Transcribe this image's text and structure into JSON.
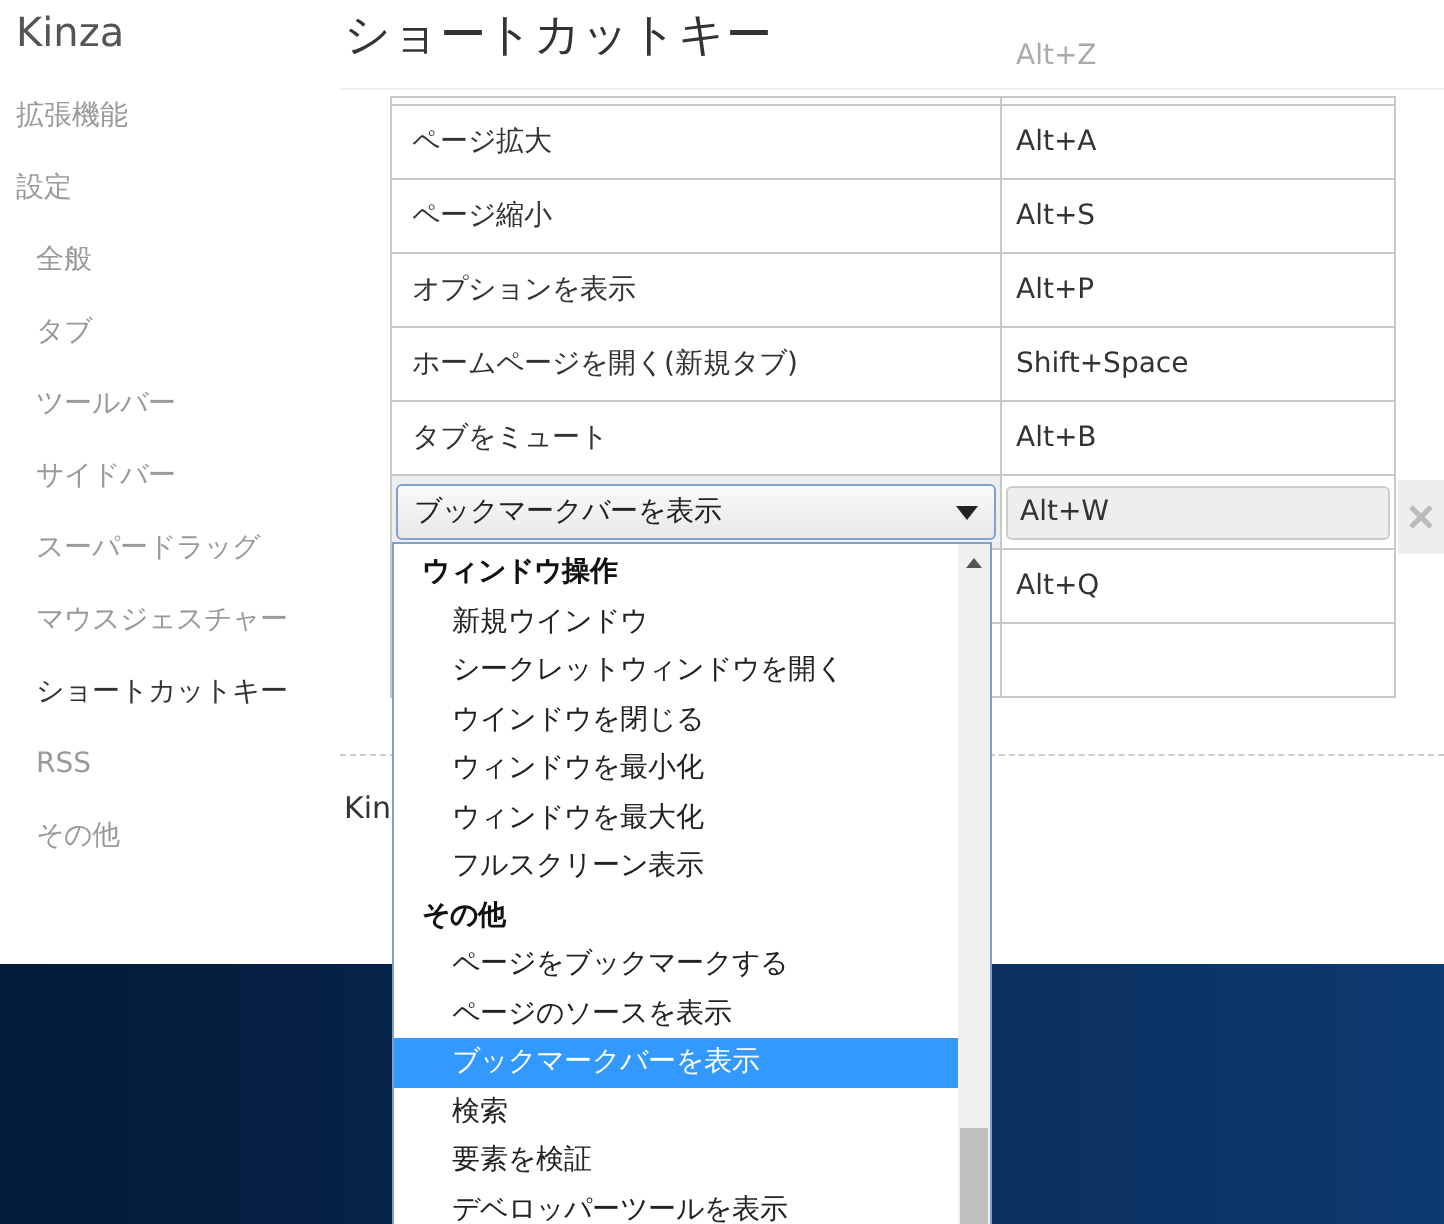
{
  "app": {
    "title": "Kinza"
  },
  "sidebar": {
    "items": [
      {
        "label": "拡張機能",
        "selected": false
      },
      {
        "label": "設定",
        "selected": false,
        "children": [
          {
            "label": "全般",
            "selected": false
          },
          {
            "label": "タブ",
            "selected": false
          },
          {
            "label": "ツールバー",
            "selected": false
          },
          {
            "label": "サイドバー",
            "selected": false
          },
          {
            "label": "スーパードラッグ",
            "selected": false
          },
          {
            "label": "マウスジェスチャー",
            "selected": false
          },
          {
            "label": "ショートカットキー",
            "selected": true
          },
          {
            "label": "RSS",
            "selected": false
          },
          {
            "label": "その他",
            "selected": false
          }
        ]
      }
    ]
  },
  "page": {
    "title": "ショートカットキー"
  },
  "shortcuts": {
    "rows": [
      {
        "kind": "faded",
        "key": "Alt+Z"
      },
      {
        "kind": "normal",
        "action": "ページ拡大",
        "key": "Alt+A"
      },
      {
        "kind": "normal",
        "action": "ページ縮小",
        "key": "Alt+S"
      },
      {
        "kind": "normal",
        "action": "オプションを表示",
        "key": "Alt+P"
      },
      {
        "kind": "normal",
        "action": "ホームページを開く(新規タブ)",
        "key": "Shift+Space"
      },
      {
        "kind": "normal",
        "action": "タブをミュート",
        "key": "Alt+B"
      },
      {
        "kind": "editing",
        "action": "ブックマークバーを表示",
        "key": "Alt+W"
      },
      {
        "kind": "normal",
        "key": "Alt+Q"
      },
      {
        "kind": "empty"
      }
    ]
  },
  "footer_text": "Kin",
  "dropdown": {
    "groups": [
      {
        "label": "ウィンドウ操作",
        "options": [
          {
            "label": "新規ウインドウ",
            "selected": false
          },
          {
            "label": "シークレットウィンドウを開く",
            "selected": false
          },
          {
            "label": "ウインドウを閉じる",
            "selected": false
          },
          {
            "label": "ウィンドウを最小化",
            "selected": false
          },
          {
            "label": "ウィンドウを最大化",
            "selected": false
          },
          {
            "label": "フルスクリーン表示",
            "selected": false
          }
        ]
      },
      {
        "label": "その他",
        "options": [
          {
            "label": "ページをブックマークする",
            "selected": false
          },
          {
            "label": "ページのソースを表示",
            "selected": false
          },
          {
            "label": "ブックマークバーを表示",
            "selected": true
          },
          {
            "label": "検索",
            "selected": false
          },
          {
            "label": "要素を検証",
            "selected": false
          },
          {
            "label": "デベロッパーツールを表示",
            "selected": false
          }
        ]
      }
    ]
  }
}
